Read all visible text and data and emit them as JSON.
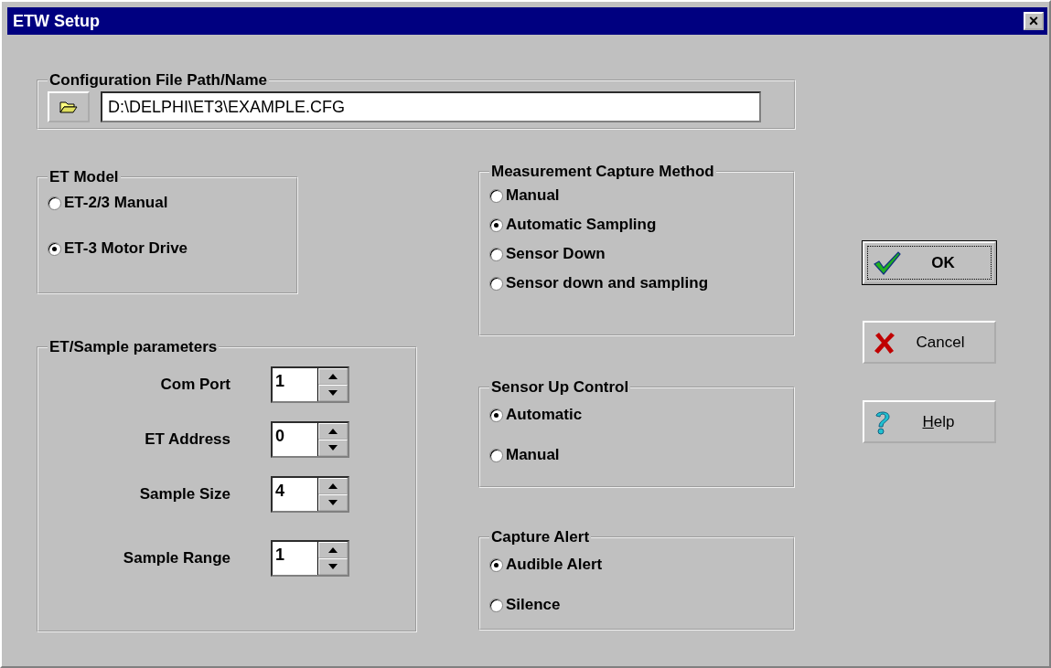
{
  "window": {
    "title": "ETW Setup",
    "close": "×"
  },
  "config_file": {
    "legend": "Configuration File Path/Name",
    "path": "D:\\DELPHI\\ET3\\EXAMPLE.CFG"
  },
  "et_model": {
    "legend": "ET Model",
    "options": [
      {
        "label": "ET-2/3 Manual",
        "selected": false
      },
      {
        "label": "ET-3 Motor Drive",
        "selected": true
      }
    ]
  },
  "parameters": {
    "legend": "ET/Sample parameters",
    "fields": [
      {
        "label": "Com Port",
        "value": "1"
      },
      {
        "label": "ET Address",
        "value": "0"
      },
      {
        "label": "Sample Size",
        "value": "4"
      },
      {
        "label": "Sample Range",
        "value": "1"
      }
    ]
  },
  "measurement": {
    "legend": "Measurement Capture Method",
    "options": [
      {
        "label": "Manual",
        "selected": false
      },
      {
        "label": "Automatic Sampling",
        "selected": true
      },
      {
        "label": "Sensor Down",
        "selected": false
      },
      {
        "label": "Sensor down and sampling",
        "selected": false
      }
    ]
  },
  "sensor_up": {
    "legend": "Sensor Up Control",
    "options": [
      {
        "label": "Automatic",
        "selected": true
      },
      {
        "label": "Manual",
        "selected": false
      }
    ]
  },
  "capture_alert": {
    "legend": "Capture Alert",
    "options": [
      {
        "label": "Audible Alert",
        "selected": true
      },
      {
        "label": "Silence",
        "selected": false
      }
    ]
  },
  "buttons": [
    {
      "label": "OK",
      "kind": "ok",
      "default": true,
      "underline_first": false
    },
    {
      "label": "Cancel",
      "kind": "cancel",
      "default": false,
      "underline_first": false
    },
    {
      "label": "Help",
      "kind": "help",
      "default": false,
      "underline_first": true
    }
  ]
}
